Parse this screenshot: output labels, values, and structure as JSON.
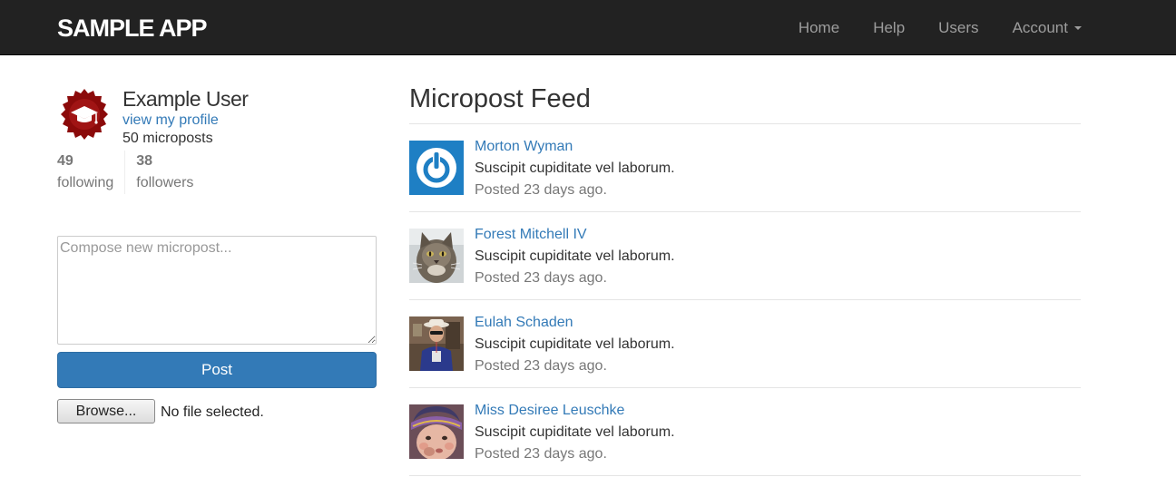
{
  "app": {
    "brand": "SAMPLE APP"
  },
  "nav": {
    "items": [
      {
        "label": "Home"
      },
      {
        "label": "Help"
      },
      {
        "label": "Users"
      },
      {
        "label": "Account"
      }
    ]
  },
  "user": {
    "name": "Example User",
    "profile_link": "view my profile",
    "micropost_count": "50 microposts",
    "following_count": "49",
    "following_label": "following",
    "followers_count": "38",
    "followers_label": "followers"
  },
  "compose": {
    "placeholder": "Compose new micropost...",
    "value": "",
    "post_label": "Post",
    "browse_label": "Browse...",
    "file_status": "No file selected."
  },
  "feed": {
    "title": "Micropost Feed",
    "items": [
      {
        "user": "Morton Wyman",
        "content": "Suscipit cupiditate vel laborum.",
        "time": "Posted 23 days ago.",
        "avatar": "power-icon"
      },
      {
        "user": "Forest Mitchell IV",
        "content": "Suscipit cupiditate vel laborum.",
        "time": "Posted 23 days ago.",
        "avatar": "cat-photo"
      },
      {
        "user": "Eulah Schaden",
        "content": "Suscipit cupiditate vel laborum.",
        "time": "Posted 23 days ago.",
        "avatar": "person-photo"
      },
      {
        "user": "Miss Desiree Leuschke",
        "content": "Suscipit cupiditate vel laborum.",
        "time": "Posted 23 days ago.",
        "avatar": "child-photo"
      }
    ]
  },
  "colors": {
    "navbar": "#222222",
    "link": "#337ab7",
    "primary": "#337ab7",
    "avatar_badge": "#8b0a0a"
  }
}
